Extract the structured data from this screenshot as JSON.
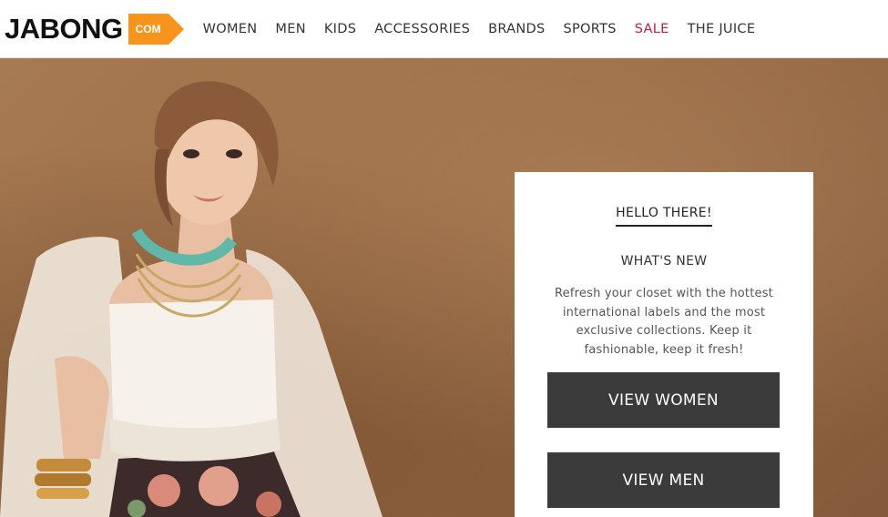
{
  "logo": {
    "text": "JABONG",
    "tag": "COM"
  },
  "nav": {
    "items": [
      {
        "label": "WOMEN"
      },
      {
        "label": "MEN"
      },
      {
        "label": "KIDS"
      },
      {
        "label": "ACCESSORIES"
      },
      {
        "label": "BRANDS"
      },
      {
        "label": "SPORTS"
      },
      {
        "label": "SALE"
      },
      {
        "label": "THE JUICE"
      }
    ]
  },
  "hero": {
    "card": {
      "greeting": "HELLO THERE!",
      "heading": "WHAT'S NEW",
      "description": "Refresh your closet with the hottest international labels and the most exclusive collections. Keep it fashionable, keep it fresh!",
      "primary_button": "VIEW WOMEN",
      "secondary_button": "VIEW MEN"
    }
  },
  "colors": {
    "logo_tag": "#f7941d",
    "sale_link": "#b7243c",
    "button_bg": "#3b3b3b",
    "hero_bg": "#9c6e47"
  }
}
